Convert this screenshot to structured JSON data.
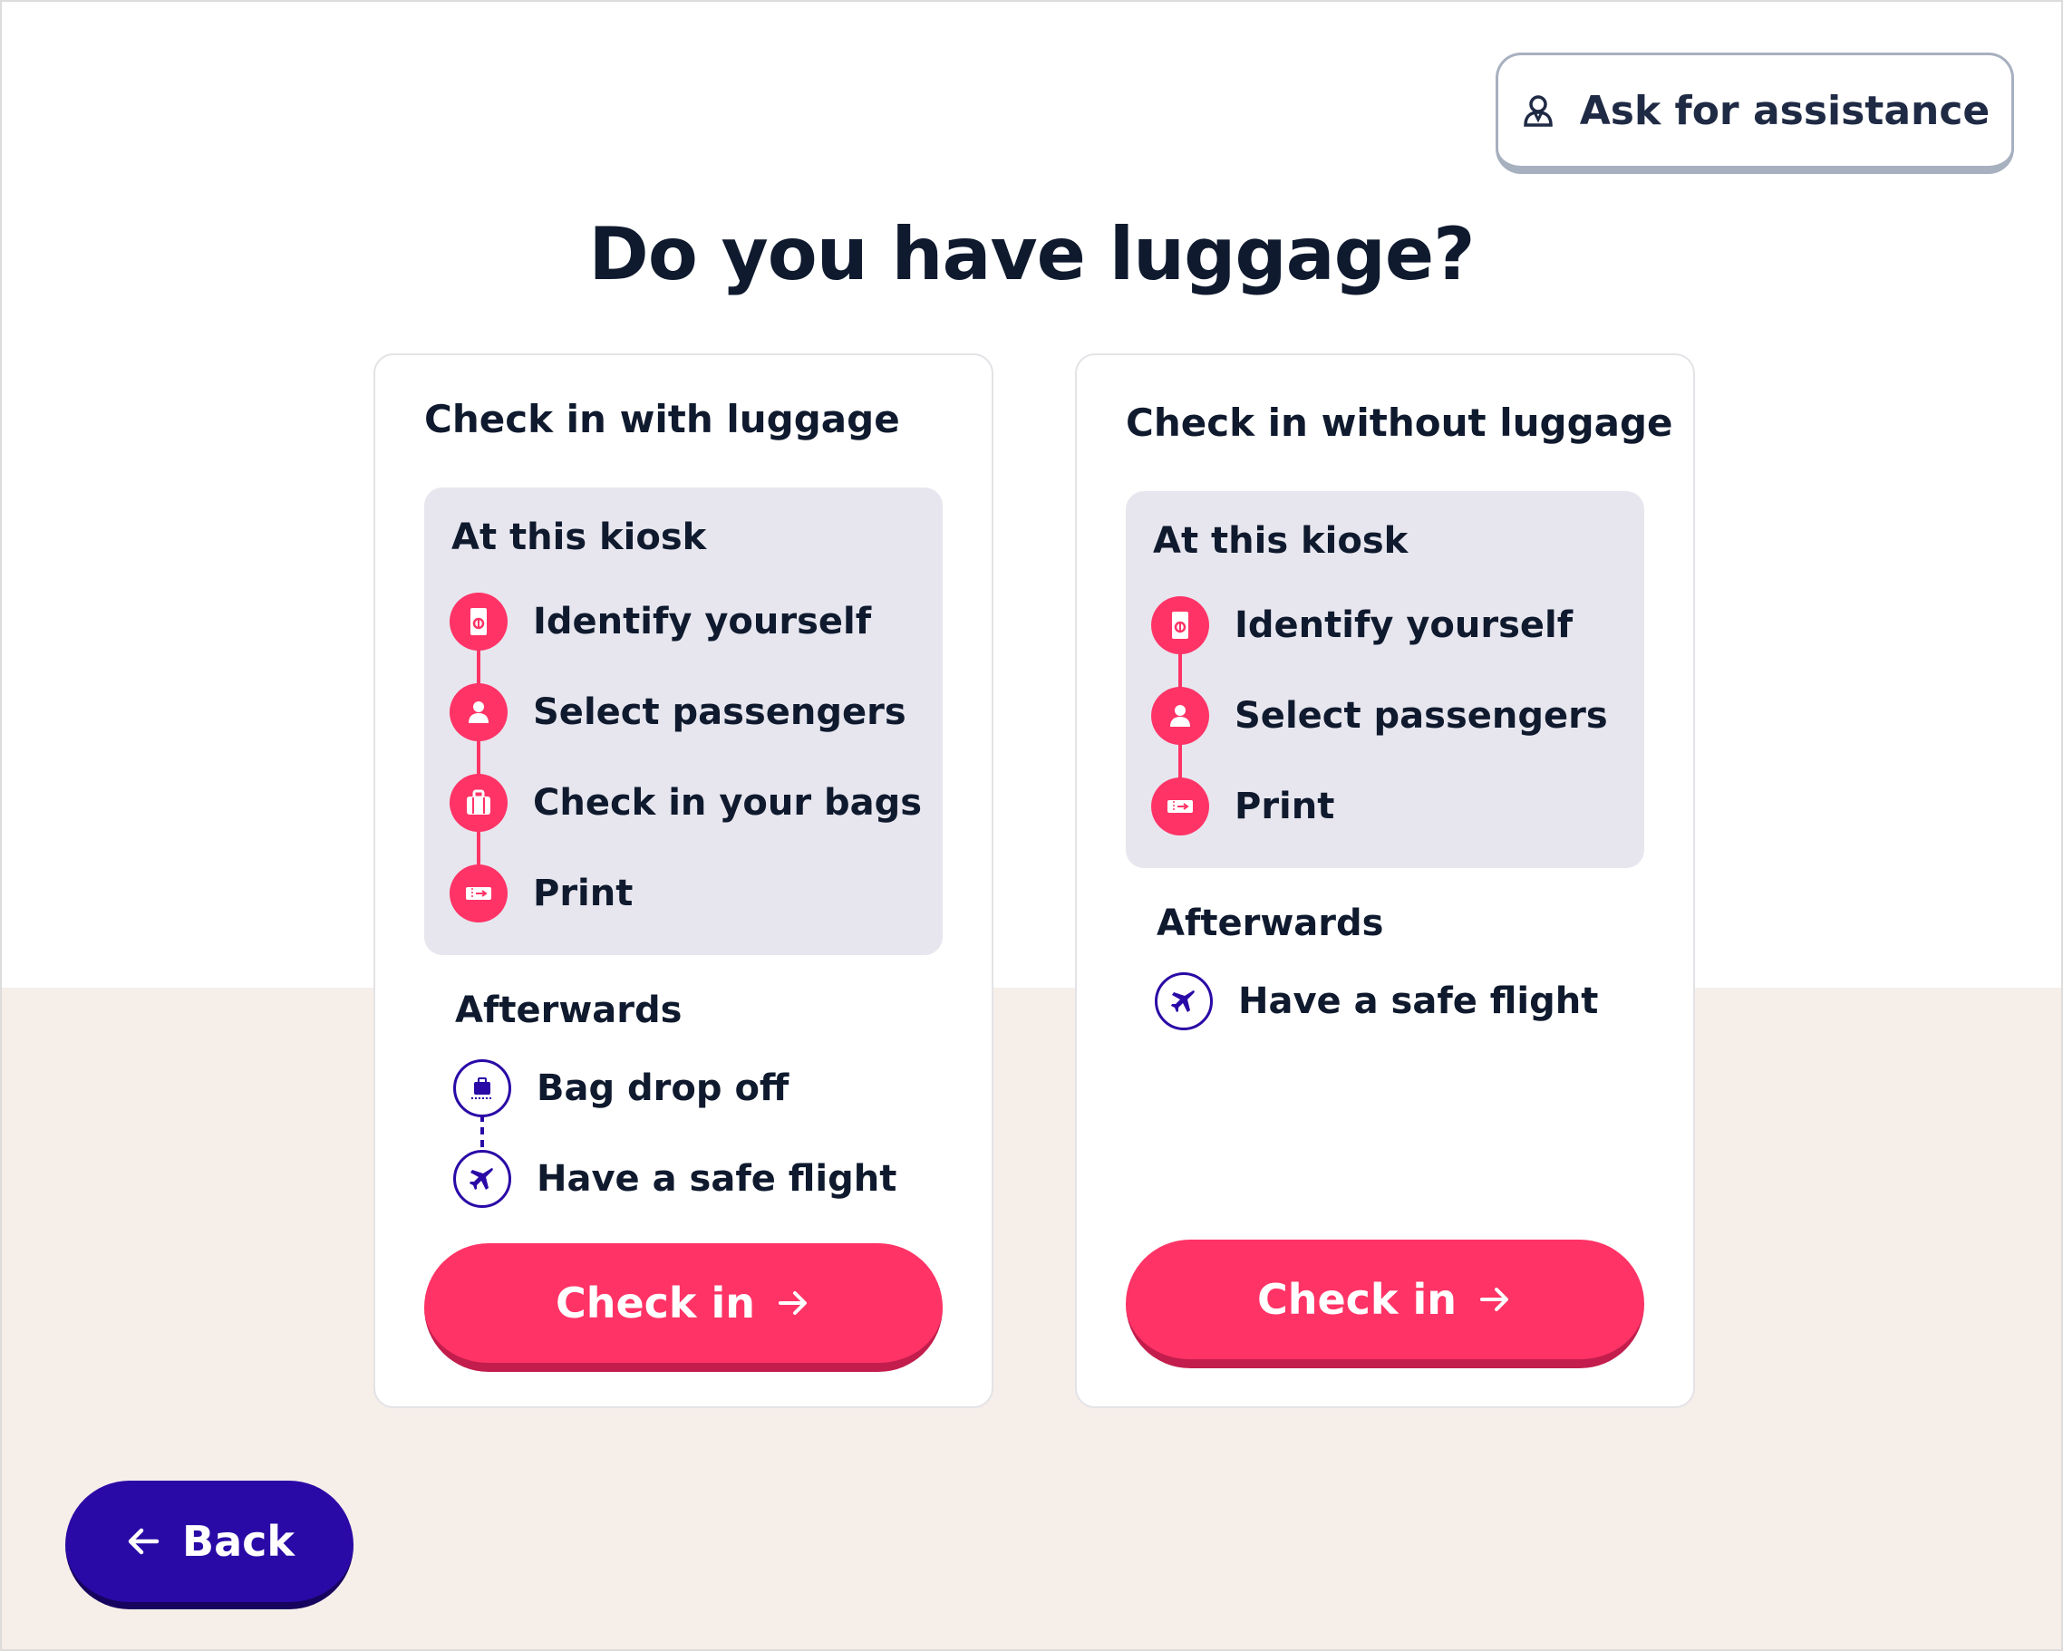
{
  "header": {
    "assist_label": "Ask for assistance",
    "assist_icon": "assistant-person-icon"
  },
  "title": "Do you have luggage?",
  "cards": [
    {
      "title": "Check in with luggage",
      "kiosk_label": "At this kiosk",
      "kiosk_steps": [
        {
          "label": "Identify yourself",
          "icon": "passport-icon"
        },
        {
          "label": "Select passengers",
          "icon": "person-icon"
        },
        {
          "label": "Check in your bags",
          "icon": "suitcase-icon"
        },
        {
          "label": "Print",
          "icon": "ticket-icon"
        }
      ],
      "after_label": "Afterwards",
      "after_steps": [
        {
          "label": "Bag drop off",
          "icon": "bag-drop-icon"
        },
        {
          "label": "Have a safe flight",
          "icon": "plane-icon"
        }
      ],
      "button_label": "Check in"
    },
    {
      "title": "Check in without luggage",
      "kiosk_label": "At this kiosk",
      "kiosk_steps": [
        {
          "label": "Identify yourself",
          "icon": "passport-icon"
        },
        {
          "label": "Select passengers",
          "icon": "person-icon"
        },
        {
          "label": "Print",
          "icon": "ticket-icon"
        }
      ],
      "after_label": "Afterwards",
      "after_steps": [
        {
          "label": "Have a safe flight",
          "icon": "plane-icon"
        }
      ],
      "button_label": "Check in"
    }
  ],
  "back_label": "Back",
  "colors": {
    "accent": "#ff3366",
    "secondary": "#2a0aa6",
    "panel": "#e7e6ee",
    "footer_bg": "#f6eee9"
  }
}
